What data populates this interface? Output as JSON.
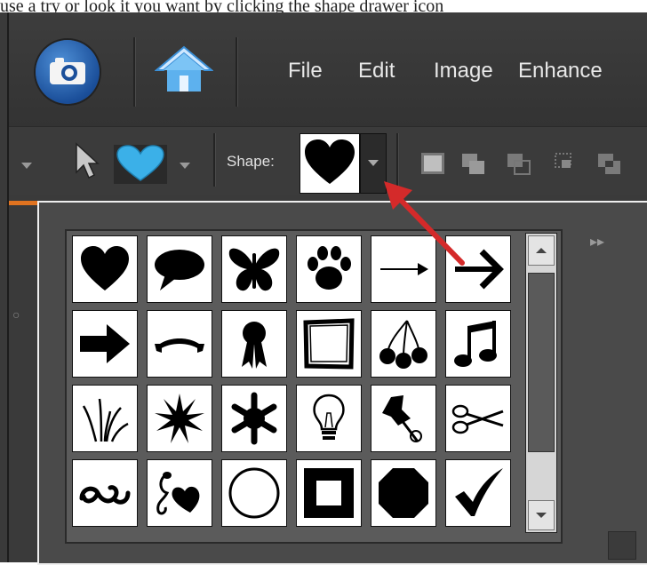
{
  "top_strip_text": "use a try or look it you want by clicking the shape drawer icon",
  "menu": {
    "file": "File",
    "edit": "Edit",
    "image": "Image",
    "enhance": "Enhance"
  },
  "options_bar": {
    "shape_label": "Shape:",
    "selected_shape": "heart-icon"
  },
  "shape_picker": {
    "rows": [
      [
        "heart-icon",
        "speech-bubble-icon",
        "butterfly-icon",
        "paw-print-icon",
        "thin-arrow-icon",
        "bold-arrow-icon"
      ],
      [
        "thick-arrow-icon",
        "banner-icon",
        "ribbon-award-icon",
        "square-frame-icon",
        "cherries-icon",
        "music-note-icon"
      ],
      [
        "grass-icon",
        "starburst-icon",
        "snowflake-icon",
        "light-bulb-icon",
        "push-pin-icon",
        "scissors-icon"
      ],
      [
        "swirl-icon",
        "leaf-heart-icon",
        "circle-frame-icon",
        "square-icon",
        "octagon-icon",
        "checkmark-icon"
      ]
    ],
    "panel_flyout": "▸▸"
  },
  "colors": {
    "accent_blue": "#3bb0e8",
    "highlight_orange": "#e07320",
    "annotation_arrow": "#d42a2a"
  }
}
